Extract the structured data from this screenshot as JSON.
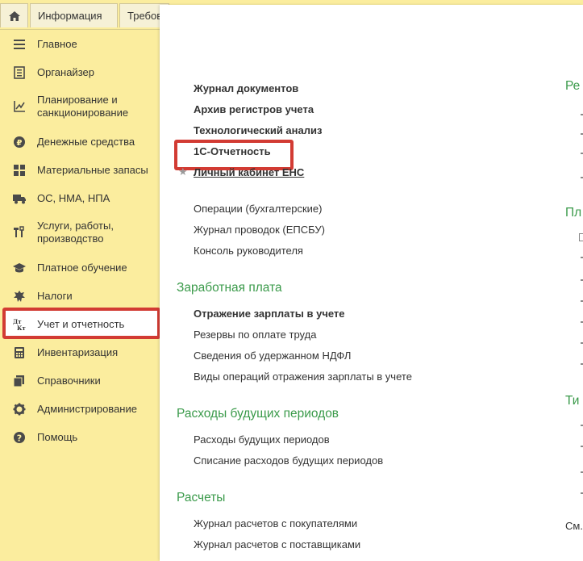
{
  "tabs": {
    "home_icon": "home-icon",
    "tab1": "Информация",
    "tab2": "Требов"
  },
  "sidebar": {
    "items": [
      {
        "label": "Главное",
        "icon": "menu-lines-icon"
      },
      {
        "label": "Органайзер",
        "icon": "organizer-icon"
      },
      {
        "label": "Планирование и санкционирование",
        "icon": "planning-chart-icon"
      },
      {
        "label": "Денежные средства",
        "icon": "money-coin-icon"
      },
      {
        "label": "Материальные запасы",
        "icon": "grid-blocks-icon"
      },
      {
        "label": "ОС, НМА, НПА",
        "icon": "truck-icon"
      },
      {
        "label": "Услуги, работы, производство",
        "icon": "tools-icon"
      },
      {
        "label": "Платное обучение",
        "icon": "graduation-cap-icon"
      },
      {
        "label": "Налоги",
        "icon": "emblem-icon"
      },
      {
        "label": "Учет и отчетность",
        "icon": "dt-kt-icon"
      },
      {
        "label": "Инвентаризация",
        "icon": "calculator-icon"
      },
      {
        "label": "Справочники",
        "icon": "books-icon"
      },
      {
        "label": "Администрирование",
        "icon": "gear-icon"
      },
      {
        "label": "Помощь",
        "icon": "question-icon"
      }
    ]
  },
  "main": {
    "top_links": [
      "Журнал документов",
      "Архив регистров учета",
      "Технологический анализ",
      "1С-Отчетность",
      "Личный кабинет ЕНС"
    ],
    "ops_links": [
      "Операции (бухгалтерские)",
      "Журнал проводок (ЕПСБУ)",
      "Консоль руководителя"
    ],
    "salary": {
      "title": "Заработная плата",
      "links": [
        "Отражение зарплаты в учете",
        "Резервы по оплате труда",
        "Сведения об удержанном НДФЛ",
        "Виды операций отражения зарплаты в учете"
      ]
    },
    "future_expenses": {
      "title": "Расходы будущих периодов",
      "links": [
        "Расходы будущих периодов",
        "Списание расходов будущих периодов"
      ]
    },
    "settlements": {
      "title": "Расчеты",
      "links": [
        "Журнал расчетов с покупателями",
        "Журнал расчетов с поставщиками"
      ]
    },
    "right_col": {
      "title1": "Ре",
      "title2": "Пл",
      "title3": "Ти",
      "footer": "См."
    }
  },
  "colors": {
    "sidebar_bg": "#fbed9e",
    "section_green": "#3a9a4a",
    "highlight_red": "#d23b33"
  }
}
